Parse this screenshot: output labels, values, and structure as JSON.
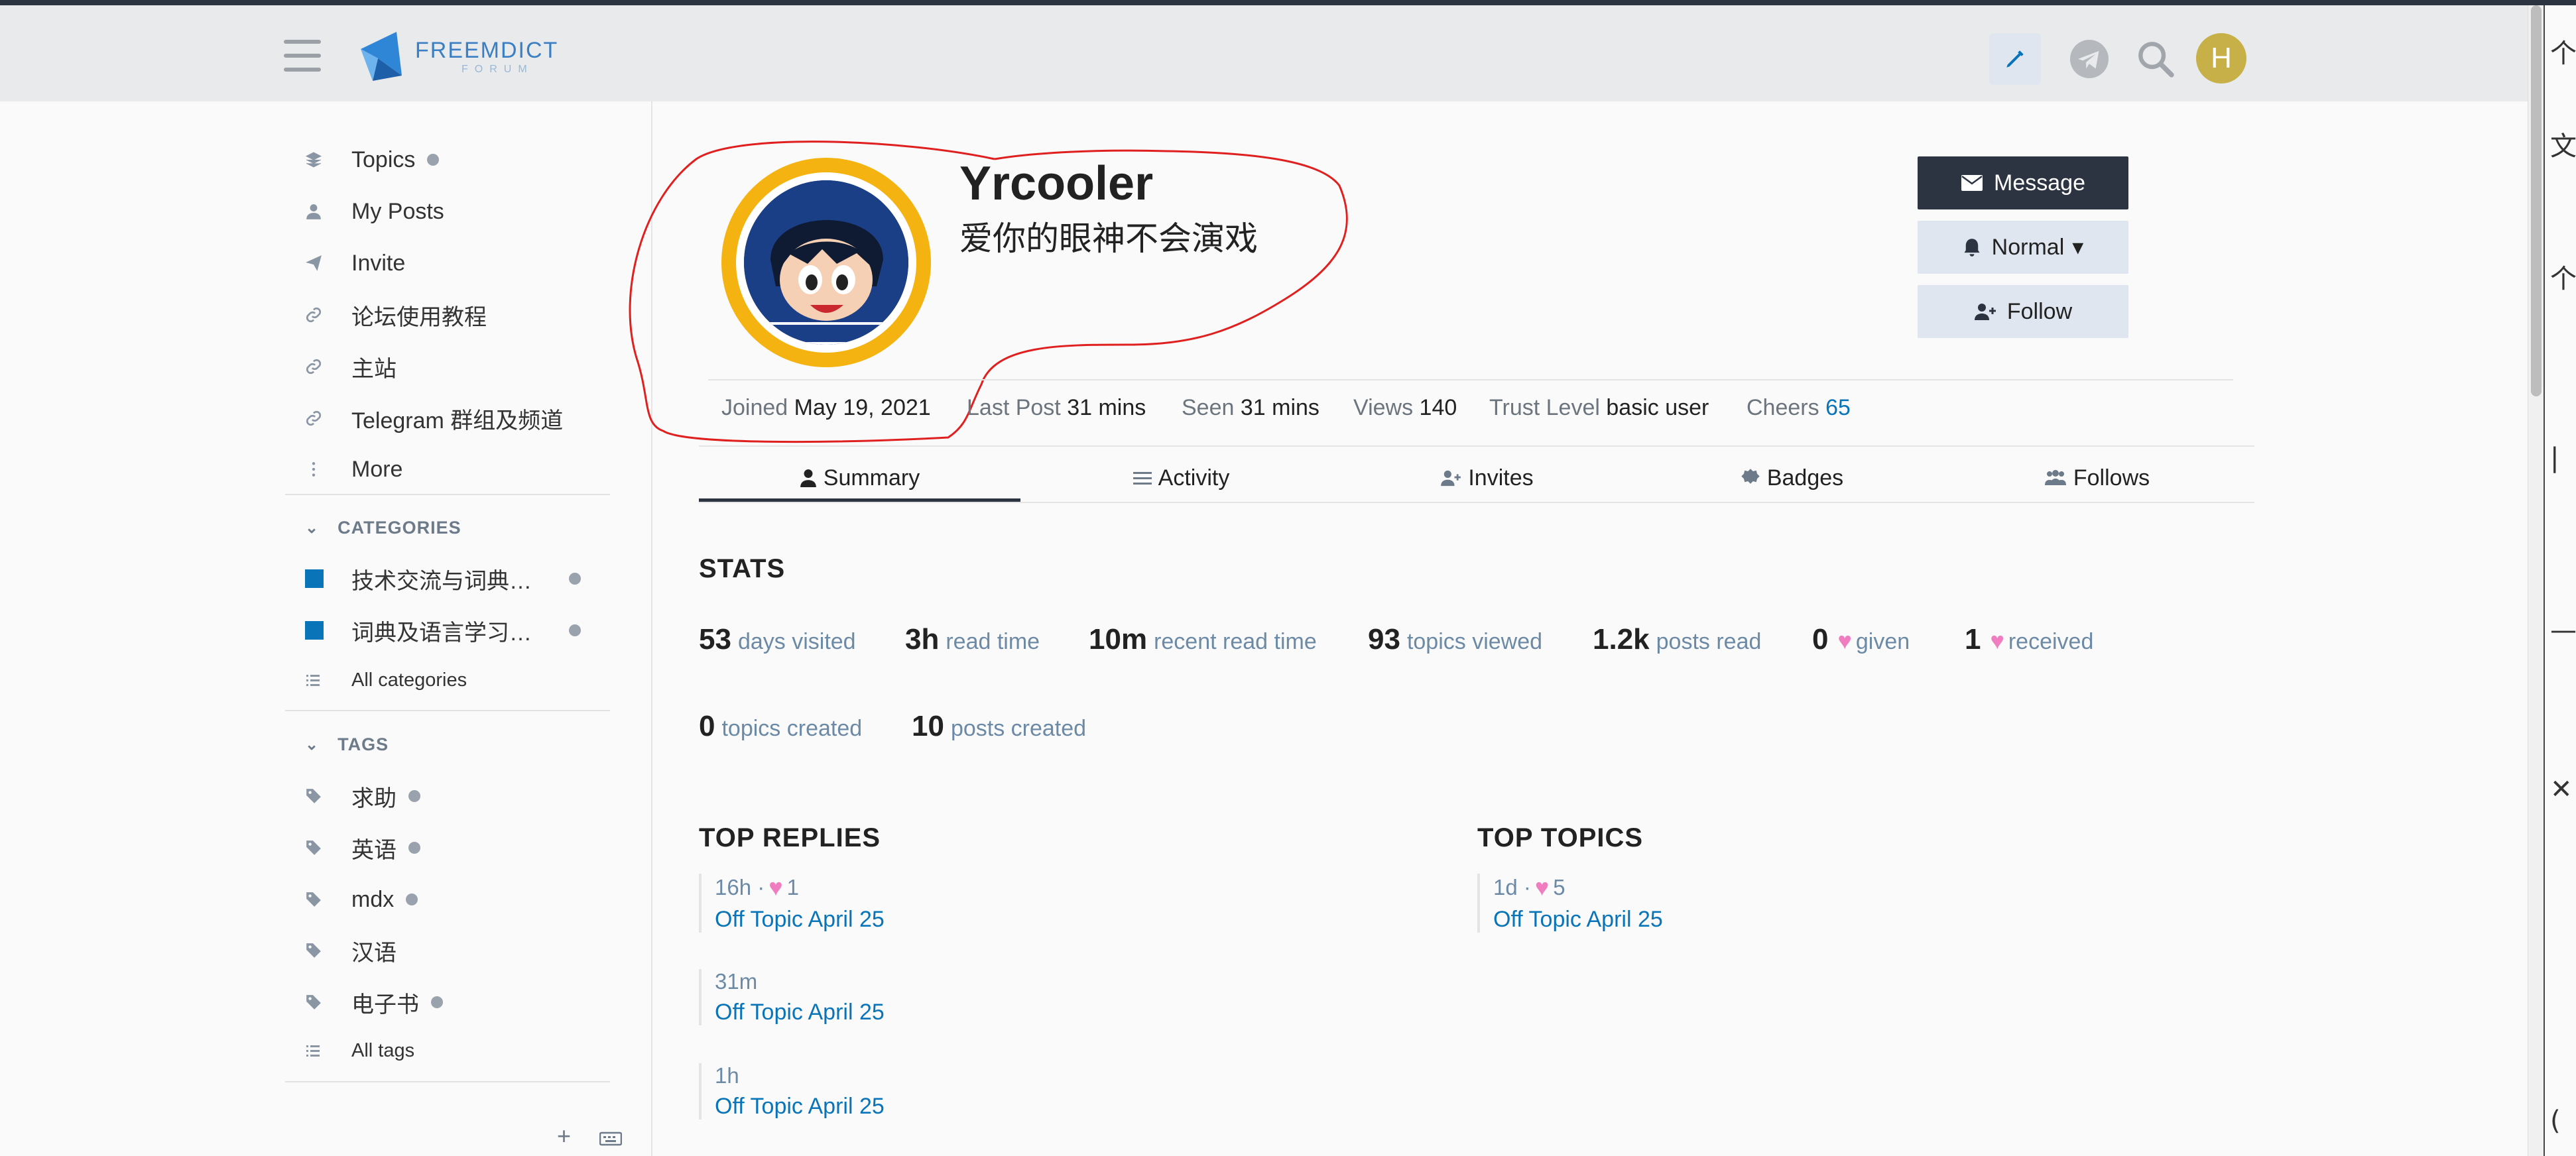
{
  "header": {
    "logo_title": "FREEMDICT",
    "logo_sub": "FORUM",
    "avatar_letter": "H"
  },
  "sidebar": {
    "items": [
      {
        "label": "Topics",
        "icon": "layers-icon",
        "dot": true
      },
      {
        "label": "My Posts",
        "icon": "user-icon",
        "dot": false
      },
      {
        "label": "Invite",
        "icon": "paper-plane-icon",
        "dot": false
      },
      {
        "label": "论坛使用教程",
        "icon": "link-icon",
        "dot": false
      },
      {
        "label": "主站",
        "icon": "link-icon",
        "dot": false
      },
      {
        "label": "Telegram 群组及频道",
        "icon": "link-icon",
        "dot": false
      },
      {
        "label": "More",
        "icon": "ellipsis-vertical-icon",
        "dot": false
      }
    ],
    "categories_header": "CATEGORIES",
    "categories": [
      {
        "label": "技术交流与词典…",
        "color": "#0a74b8"
      },
      {
        "label": "词典及语言学习…",
        "color": "#0a74b8"
      }
    ],
    "all_categories": "All categories",
    "tags_header": "TAGS",
    "tags": [
      {
        "label": "求助",
        "dot": true
      },
      {
        "label": "英语",
        "dot": true
      },
      {
        "label": "mdx",
        "dot": true
      },
      {
        "label": "汉语",
        "dot": false
      },
      {
        "label": "电子书",
        "dot": true
      }
    ],
    "all_tags": "All tags"
  },
  "profile": {
    "username": "Yrcooler",
    "bio": "爱你的眼神不会演戏",
    "buttons": {
      "message": "Message",
      "notification": "Normal",
      "follow": "Follow"
    },
    "meta": {
      "joined_label": "Joined",
      "joined_value": "May 19, 2021",
      "last_post_label": "Last Post",
      "last_post_value": "31 mins",
      "seen_label": "Seen",
      "seen_value": "31 mins",
      "views_label": "Views",
      "views_value": "140",
      "trust_label": "Trust Level",
      "trust_value": "basic user",
      "cheers_label": "Cheers",
      "cheers_value": "65"
    }
  },
  "tabs": [
    "Summary",
    "Activity",
    "Invites",
    "Badges",
    "Follows"
  ],
  "stats": {
    "title": "STATS",
    "items": [
      {
        "value": "53",
        "label": "days visited"
      },
      {
        "value": "3h",
        "label": "read time"
      },
      {
        "value": "10m",
        "label": "recent read time"
      },
      {
        "value": "93",
        "label": "topics viewed"
      },
      {
        "value": "1.2k",
        "label": "posts read"
      },
      {
        "value": "0",
        "label": "given"
      },
      {
        "value": "1",
        "label": "received"
      },
      {
        "value": "0",
        "label": "topics created"
      },
      {
        "value": "10",
        "label": "posts created"
      }
    ]
  },
  "top_replies": {
    "title": "TOP REPLIES",
    "items": [
      {
        "time": "16h",
        "likes": "1",
        "title": "Off Topic April 25"
      },
      {
        "time": "31m",
        "likes": "",
        "title": "Off Topic April 25"
      },
      {
        "time": "1h",
        "likes": "",
        "title": "Off Topic April 25"
      }
    ]
  },
  "top_topics": {
    "title": "TOP TOPICS",
    "items": [
      {
        "time": "1d",
        "likes": "5",
        "title": "Off Topic April 25"
      }
    ]
  },
  "colors": {
    "accent": "#0a74b8",
    "dark_button": "#2b3440",
    "heart": "#f07dbf",
    "annotation": "#e0201f"
  },
  "sliver_text": [
    "个",
    "文",
    "个",
    "|",
    "—",
    "✕",
    "("
  ]
}
